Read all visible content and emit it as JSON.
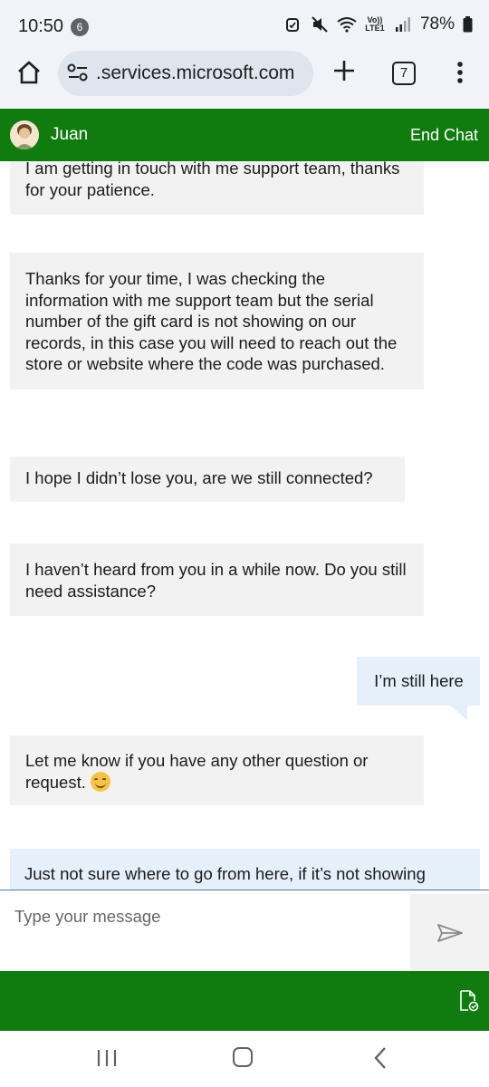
{
  "status_bar": {
    "time": "10:50",
    "notification_count": "6",
    "network_label_top": "Vo))",
    "network_label_bottom": "LTE1",
    "battery": "78%"
  },
  "browser": {
    "url": ".services.microsoft.com",
    "tab_count": "7"
  },
  "chat_header": {
    "agent_name": "Juan",
    "end_chat_label": "End Chat"
  },
  "messages": [
    {
      "sender": "agent",
      "text": "I am getting in touch with me support team, thanks for your patience."
    },
    {
      "sender": "agent",
      "text": "Thanks for your time, I was checking the information with me support team but the serial number of the gift card is not showing on our records, in this case you will need to reach out the store or website where the code was purchased."
    },
    {
      "sender": "agent",
      "text": "I hope I didn’t lose you, are we still connected?"
    },
    {
      "sender": "agent",
      "text": "I haven’t heard from you in a while now. Do you still need assistance?"
    },
    {
      "sender": "user",
      "text": "I’m still here"
    },
    {
      "sender": "agent",
      "text": "Let me know if you have any other question or request. "
    },
    {
      "sender": "user",
      "text": "Just not sure where to go from here, if it’s not showing"
    }
  ],
  "composer": {
    "placeholder": "Type your message"
  },
  "colors": {
    "brand_green": "#107c10",
    "agent_bubble": "#f2f2f2",
    "user_bubble": "#e5f0fb"
  },
  "icons": [
    "home-icon",
    "site-settings-icon",
    "new-tab-icon",
    "tab-switcher-icon",
    "more-menu-icon",
    "send-icon",
    "download-transcript-icon",
    "recents-icon",
    "nav-home-icon",
    "back-icon"
  ]
}
